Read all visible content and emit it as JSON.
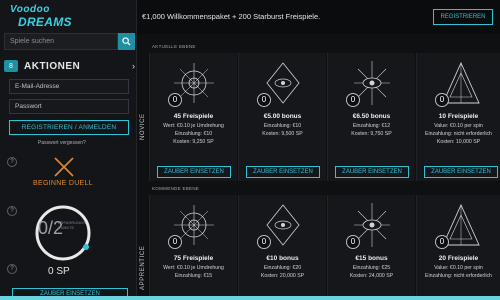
{
  "sidebar": {
    "logo_line1": "Voodoo",
    "logo_line2": "DREAMS",
    "search_placeholder": "Spiele suchen",
    "actions_count": "8",
    "actions_label": "AKTIONEN",
    "email_placeholder": "E-Mail-Adresse",
    "password_placeholder": "Passwort",
    "register_login_label": "REGISTRIEREN / ANMELDEN",
    "forgot_password": "Passwort vergessen?",
    "duel_label": "BEGINNE DUELL",
    "ring_value": "0/2",
    "ring_sub": "ERFAHRUNGS PUNKTE",
    "sp_value": "0 SP",
    "zauber_label": "ZAUBER EINSETZEN",
    "accent": "#2ec3d6",
    "duel_color": "#e08a2e"
  },
  "topbar": {
    "promo_text": "€1,000 Willkommenspaket + 200 Starburst Freispiele.",
    "register_label": "REGISTRIEREN"
  },
  "sections": [
    {
      "label": "AKTUELLE EBENE",
      "tier": "NOVICE",
      "cards": [
        {
          "icon": "sun-rune-icon",
          "count": "0",
          "title": "45 Freispiele",
          "line1": "Wert: €0.10 je Umdrehung",
          "line2": "Einzahlung: €10",
          "line3": "Kosten: 9,250 SP",
          "button": "ZAUBER EINSETZEN"
        },
        {
          "icon": "diamond-eye-icon",
          "count": "0",
          "title": "€5.00 bonus",
          "line1": "Einzahlung: €10",
          "line2": "Kosten: 9,500 SP",
          "line3": "",
          "button": "ZAUBER EINSETZEN"
        },
        {
          "icon": "starburst-eye-icon",
          "count": "0",
          "title": "€6.50 bonus",
          "line1": "Einzahlung: €12",
          "line2": "Kosten: 9,750 SP",
          "line3": "",
          "button": "ZAUBER EINSETZEN"
        },
        {
          "icon": "pyramid-icon",
          "count": "0",
          "title": "10 Freispiele",
          "line1": "Value: €0.10 per spin",
          "line2": "Einzahlung: nicht erforderlich",
          "line3": "Kosten: 10,000 SP",
          "button": "ZAUBER EINSETZEN"
        }
      ]
    },
    {
      "label": "KOMMENDE EBENE",
      "tier": "APPRENTICE",
      "cards": [
        {
          "icon": "sun-rune-icon",
          "count": "0",
          "title": "75 Freispiele",
          "line1": "Wert: €0.10 je Umdrehung",
          "line2": "Einzahlung: €15",
          "line3": "",
          "button": ""
        },
        {
          "icon": "diamond-eye-icon",
          "count": "0",
          "title": "€10 bonus",
          "line1": "Einzahlung: €20",
          "line2": "Kosten: 20,000 SP",
          "line3": "",
          "button": ""
        },
        {
          "icon": "starburst-eye-icon",
          "count": "0",
          "title": "€15 bonus",
          "line1": "Einzahlung: €25",
          "line2": "Kosten: 24,000 SP",
          "line3": "",
          "button": ""
        },
        {
          "icon": "pyramid-icon",
          "count": "0",
          "title": "20 Freispiele",
          "line1": "Value: €0.10 per spin",
          "line2": "Einzahlung: nicht erforderlich",
          "line3": "",
          "button": ""
        }
      ]
    }
  ]
}
